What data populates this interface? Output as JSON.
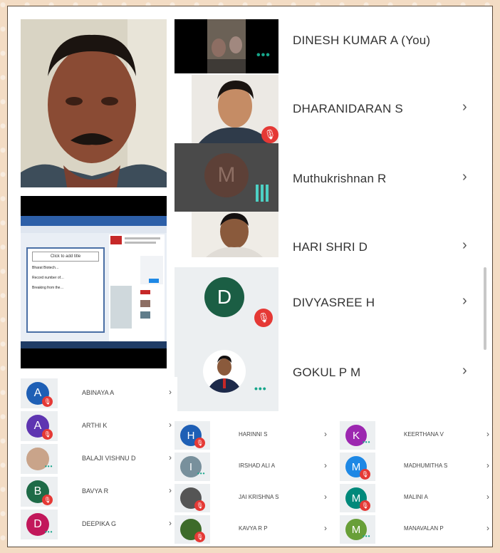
{
  "main_list": [
    {
      "name": "DINESH KUMAR A (You)"
    },
    {
      "name": "DHARANIDARAN S"
    },
    {
      "name": "Muthukrishnan R"
    },
    {
      "name": "HARI SHRI D"
    },
    {
      "name": "DIVYASREE H"
    },
    {
      "name": "GOKUL P M"
    }
  ],
  "tiles": {
    "m_initial": "M",
    "d_initial": "D"
  },
  "slide": {
    "title": "Click to add title",
    "bullets": [
      "Bharat Biotech…",
      "Record number of…",
      "Breaking from the…"
    ]
  },
  "col1": [
    {
      "initial": "A",
      "name": "ABINAYA A",
      "color": "#1e5fb5",
      "status": "mic-off"
    },
    {
      "initial": "A",
      "name": "ARTHI K",
      "color": "#5e35b1",
      "status": "mic-off"
    },
    {
      "initial": "",
      "name": "BALAJI VISHNU D",
      "color": "#c9a48a",
      "status": "dots"
    },
    {
      "initial": "B",
      "name": "BAVYA R",
      "color": "#1e6b47",
      "status": "mic-off"
    },
    {
      "initial": "D",
      "name": "DEEPIKA G",
      "color": "#c2185b",
      "status": "dots"
    }
  ],
  "col2": [
    {
      "initial": "H",
      "name": "HARINNI S",
      "color": "#1e5fb5",
      "status": "mic-off"
    },
    {
      "initial": "I",
      "name": "IRSHAD ALI A",
      "color": "#78909c",
      "status": "dots"
    },
    {
      "initial": "",
      "name": "JAI KRISHNA S",
      "color": "#555",
      "status": "mic-off"
    },
    {
      "initial": "",
      "name": "KAVYA R P",
      "color": "#3d6b2a",
      "status": "mic-off"
    }
  ],
  "col3": [
    {
      "initial": "K",
      "name": "KEERTHANA V",
      "color": "#9c27b0",
      "status": "dots"
    },
    {
      "initial": "M",
      "name": "MADHUMITHA S",
      "color": "#1e88e5",
      "status": "mic-off"
    },
    {
      "initial": "M",
      "name": "MALINI A",
      "color": "#00897b",
      "status": "mic-off"
    },
    {
      "initial": "M",
      "name": "MANAVALAN P",
      "color": "#689f38",
      "status": "dots"
    }
  ],
  "colors": {
    "mic_off": "#e53935",
    "speaking": "#16a58a",
    "chevron": "#555555"
  }
}
